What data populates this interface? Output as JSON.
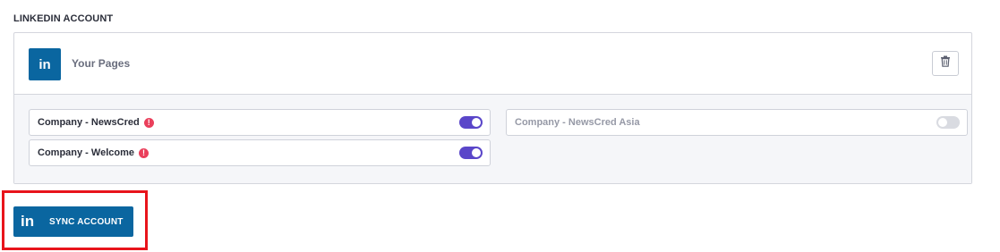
{
  "section": {
    "label": "LINKEDIN ACCOUNT"
  },
  "card": {
    "logo_text": "in",
    "title": "Your Pages",
    "delete_icon": "trash-icon",
    "pages": [
      {
        "name": "Company - NewsCred",
        "warning": "!",
        "enabled": true
      },
      {
        "name": "Company - Welcome",
        "warning": "!",
        "enabled": true
      },
      {
        "name": "Company - NewsCred Asia",
        "warning": "",
        "enabled": false
      }
    ]
  },
  "sync": {
    "logo_text": "in",
    "label": "SYNC ACCOUNT"
  },
  "colors": {
    "linkedin_blue": "#0a66a0",
    "toggle_on": "#5a46c9",
    "toggle_off": "#d9dbe1",
    "alert": "#ea3f5b",
    "highlight": "#e8141b"
  }
}
